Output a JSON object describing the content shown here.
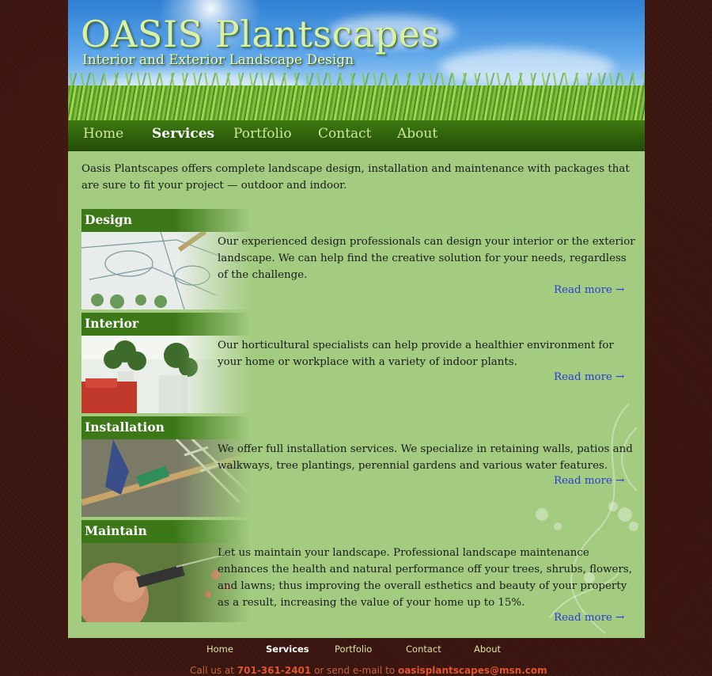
{
  "header": {
    "title": "OASIS Plantscapes",
    "tagline": "Interior and Exterior Landscape Design"
  },
  "nav": [
    {
      "label": "Home"
    },
    {
      "label": "Services",
      "active": true
    },
    {
      "label": "Portfolio"
    },
    {
      "label": "Contact"
    },
    {
      "label": "About"
    }
  ],
  "intro": "Oasis Plantscapes offers complete landscape design, installation and maintenance with packages that are sure to fit your project — outdoor and indoor.",
  "services": [
    {
      "title": "Design",
      "text": "Our experienced design professionals can design your interior or the exterior landscape. We can help find the creative solution for your needs, regardless of the challenge.",
      "link": "Read more →"
    },
    {
      "title": "Interior",
      "text": "Our horticultural specialists can help provide a healthier environment for your home or workplace with a variety of indoor plants.",
      "link": "Read more →"
    },
    {
      "title": "Installation",
      "text": "We offer full installation services. We specialize in retaining walls, patios and walkways, tree plantings, perennial gardens and various water features.",
      "link": "Read more →"
    },
    {
      "title": "Maintain",
      "text": "Let us maintain your landscape. Professional landscape maintenance enhances the health and natural performance off your trees, shrubs, flowers, and lawns; thus improving the overall esthetics and beauty of your property as a result, increasing the value of your home up to 15%.",
      "link": "Read more →"
    }
  ],
  "footer": {
    "nav": [
      "Home",
      "Services",
      "Portfolio",
      "Contact",
      "About"
    ],
    "contact_prefix": "Call us at",
    "phone": "701-361-2401",
    "contact_middle": "or send e-mail to",
    "email": "oasisplantscapes@msn.com"
  },
  "colors": {
    "page_bg": "#3a1510",
    "content_bg": "#a3cc80",
    "nav_bg": "#2d5e0a",
    "link": "#2a3bd8"
  }
}
